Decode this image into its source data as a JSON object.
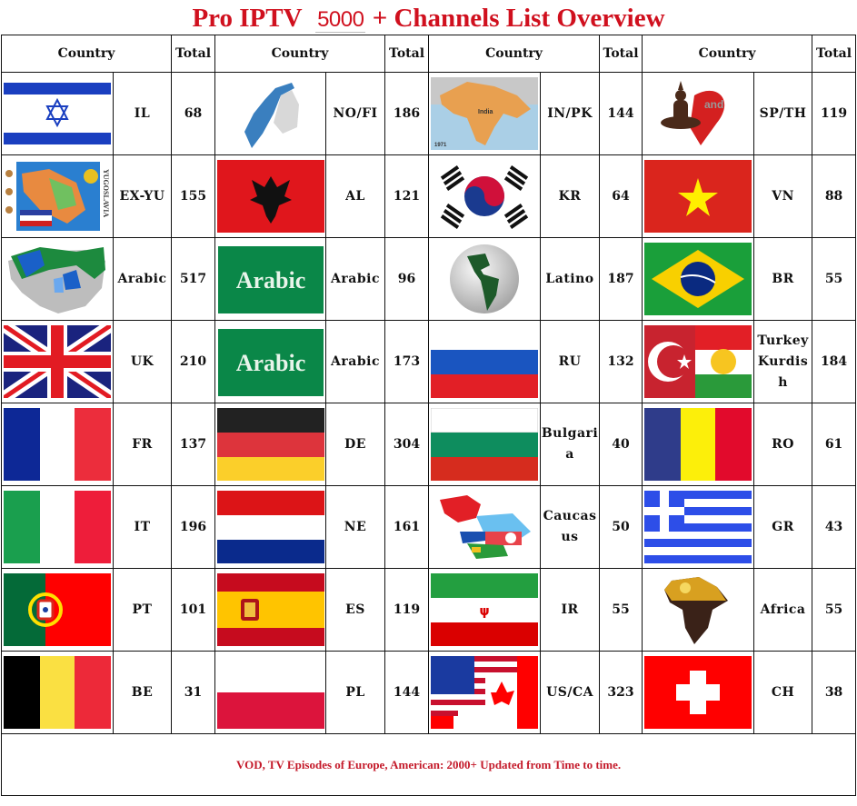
{
  "title": {
    "prefix": "Pro IPTV",
    "number": "5000",
    "suffix": "+ Channels List Overview"
  },
  "headers": {
    "country": "Country",
    "total": "Total"
  },
  "colors": {
    "title_red": "#d0101e",
    "footer_red": "#c41a2a",
    "grid": "#111111"
  },
  "rows": [
    [
      {
        "icon": "israel-flag-icon",
        "code": "IL",
        "total": "68"
      },
      {
        "icon": "norway-finland-map-icon",
        "code": "NO/FI",
        "total": "186"
      },
      {
        "icon": "india-pakistan-map-icon",
        "code": "IN/PK",
        "total": "144",
        "map_labels": [
          "India",
          "1971"
        ]
      },
      {
        "icon": "thailand-buddha-logo-icon",
        "code": "SP/TH",
        "total": "119",
        "logo_text": "Thailand"
      }
    ],
    [
      {
        "icon": "yugoslavia-map-icon",
        "code": "EX-YU",
        "total": "155",
        "map_label": "YUGOSLAVIA"
      },
      {
        "icon": "albania-flag-icon",
        "code": "AL",
        "total": "121"
      },
      {
        "icon": "south-korea-flag-icon",
        "code": "KR",
        "total": "64"
      },
      {
        "icon": "vietnam-flag-icon",
        "code": "VN",
        "total": "88"
      }
    ],
    [
      {
        "icon": "arab-world-map-icon",
        "code": "Arabic",
        "total": "517"
      },
      {
        "icon": "arabic-green-badge-icon",
        "code": "Arabic",
        "total": "96",
        "badge_text": "Arabic"
      },
      {
        "icon": "latin-america-globe-icon",
        "code": "Latino",
        "total": "187"
      },
      {
        "icon": "brazil-flag-icon",
        "code": "BR",
        "total": "55"
      }
    ],
    [
      {
        "icon": "uk-flag-icon",
        "code": "UK",
        "total": "210"
      },
      {
        "icon": "arabic-green-badge-icon",
        "code": "Arabic",
        "total": "173",
        "badge_text": "Arabic"
      },
      {
        "icon": "russia-flag-icon",
        "code": "RU",
        "total": "132"
      },
      {
        "icon": "turkey-kurdistan-flag-icon",
        "code": "Turkey Kurdish",
        "total": "184"
      }
    ],
    [
      {
        "icon": "france-flag-icon",
        "code": "FR",
        "total": "137"
      },
      {
        "icon": "germany-flag-icon",
        "code": "DE",
        "total": "304"
      },
      {
        "icon": "bulgaria-flag-icon",
        "code": "Bulgaria",
        "total": "40"
      },
      {
        "icon": "romania-flag-icon",
        "code": "RO",
        "total": "61"
      }
    ],
    [
      {
        "icon": "italy-flag-icon",
        "code": "IT",
        "total": "196"
      },
      {
        "icon": "netherlands-flag-icon",
        "code": "NE",
        "total": "161"
      },
      {
        "icon": "caucasus-map-icon",
        "code": "Caucasus",
        "total": "50"
      },
      {
        "icon": "greece-flag-icon",
        "code": "GR",
        "total": "43"
      }
    ],
    [
      {
        "icon": "portugal-flag-icon",
        "code": "PT",
        "total": "101"
      },
      {
        "icon": "spain-flag-icon",
        "code": "ES",
        "total": "119"
      },
      {
        "icon": "iran-flag-icon",
        "code": "IR",
        "total": "55"
      },
      {
        "icon": "africa-map-icon",
        "code": "Africa",
        "total": "55"
      }
    ],
    [
      {
        "icon": "belgium-flag-icon",
        "code": "BE",
        "total": "31"
      },
      {
        "icon": "poland-flag-icon",
        "code": "PL",
        "total": "144"
      },
      {
        "icon": "usa-canada-flag-icon",
        "code": "US/CA",
        "total": "323"
      },
      {
        "icon": "switzerland-flag-icon",
        "code": "CH",
        "total": "38"
      }
    ]
  ],
  "footer": "VOD, TV Episodes of Europe, American: 2000+ Updated from Time to time."
}
